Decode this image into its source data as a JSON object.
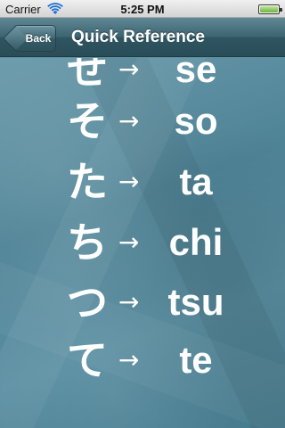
{
  "status_bar": {
    "carrier": "Carrier",
    "time": "5:25 PM",
    "wifi_icon": "wifi-icon",
    "battery_icon": "battery-icon"
  },
  "nav_bar": {
    "back_label": "Back",
    "title": "Quick Reference"
  },
  "rows": [
    {
      "kana": "せ",
      "arrow": "→",
      "romaji": "se"
    },
    {
      "kana": "そ",
      "arrow": "→",
      "romaji": "so"
    },
    {
      "kana": "た",
      "arrow": "→",
      "romaji": "ta"
    },
    {
      "kana": "ち",
      "arrow": "→",
      "romaji": "chi"
    },
    {
      "kana": "つ",
      "arrow": "→",
      "romaji": "tsu"
    },
    {
      "kana": "て",
      "arrow": "→",
      "romaji": "te"
    }
  ],
  "colors": {
    "nav_bar": "#3c6470",
    "background": "#5a8ea0",
    "text": "#ffffff"
  }
}
